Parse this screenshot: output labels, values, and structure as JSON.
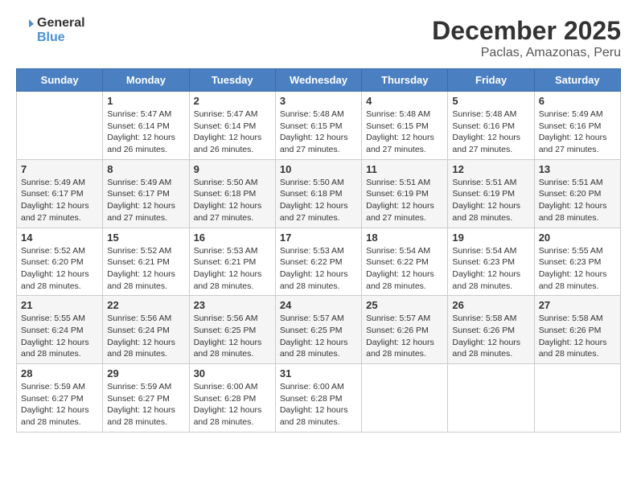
{
  "logo": {
    "line1": "General",
    "line2": "Blue"
  },
  "title": "December 2025",
  "subtitle": "Paclas, Amazonas, Peru",
  "weekdays": [
    "Sunday",
    "Monday",
    "Tuesday",
    "Wednesday",
    "Thursday",
    "Friday",
    "Saturday"
  ],
  "weeks": [
    [
      {
        "day": "",
        "info": ""
      },
      {
        "day": "1",
        "info": "Sunrise: 5:47 AM\nSunset: 6:14 PM\nDaylight: 12 hours\nand 26 minutes."
      },
      {
        "day": "2",
        "info": "Sunrise: 5:47 AM\nSunset: 6:14 PM\nDaylight: 12 hours\nand 26 minutes."
      },
      {
        "day": "3",
        "info": "Sunrise: 5:48 AM\nSunset: 6:15 PM\nDaylight: 12 hours\nand 27 minutes."
      },
      {
        "day": "4",
        "info": "Sunrise: 5:48 AM\nSunset: 6:15 PM\nDaylight: 12 hours\nand 27 minutes."
      },
      {
        "day": "5",
        "info": "Sunrise: 5:48 AM\nSunset: 6:16 PM\nDaylight: 12 hours\nand 27 minutes."
      },
      {
        "day": "6",
        "info": "Sunrise: 5:49 AM\nSunset: 6:16 PM\nDaylight: 12 hours\nand 27 minutes."
      }
    ],
    [
      {
        "day": "7",
        "info": "Sunrise: 5:49 AM\nSunset: 6:17 PM\nDaylight: 12 hours\nand 27 minutes."
      },
      {
        "day": "8",
        "info": "Sunrise: 5:49 AM\nSunset: 6:17 PM\nDaylight: 12 hours\nand 27 minutes."
      },
      {
        "day": "9",
        "info": "Sunrise: 5:50 AM\nSunset: 6:18 PM\nDaylight: 12 hours\nand 27 minutes."
      },
      {
        "day": "10",
        "info": "Sunrise: 5:50 AM\nSunset: 6:18 PM\nDaylight: 12 hours\nand 27 minutes."
      },
      {
        "day": "11",
        "info": "Sunrise: 5:51 AM\nSunset: 6:19 PM\nDaylight: 12 hours\nand 27 minutes."
      },
      {
        "day": "12",
        "info": "Sunrise: 5:51 AM\nSunset: 6:19 PM\nDaylight: 12 hours\nand 28 minutes."
      },
      {
        "day": "13",
        "info": "Sunrise: 5:51 AM\nSunset: 6:20 PM\nDaylight: 12 hours\nand 28 minutes."
      }
    ],
    [
      {
        "day": "14",
        "info": "Sunrise: 5:52 AM\nSunset: 6:20 PM\nDaylight: 12 hours\nand 28 minutes."
      },
      {
        "day": "15",
        "info": "Sunrise: 5:52 AM\nSunset: 6:21 PM\nDaylight: 12 hours\nand 28 minutes."
      },
      {
        "day": "16",
        "info": "Sunrise: 5:53 AM\nSunset: 6:21 PM\nDaylight: 12 hours\nand 28 minutes."
      },
      {
        "day": "17",
        "info": "Sunrise: 5:53 AM\nSunset: 6:22 PM\nDaylight: 12 hours\nand 28 minutes."
      },
      {
        "day": "18",
        "info": "Sunrise: 5:54 AM\nSunset: 6:22 PM\nDaylight: 12 hours\nand 28 minutes."
      },
      {
        "day": "19",
        "info": "Sunrise: 5:54 AM\nSunset: 6:23 PM\nDaylight: 12 hours\nand 28 minutes."
      },
      {
        "day": "20",
        "info": "Sunrise: 5:55 AM\nSunset: 6:23 PM\nDaylight: 12 hours\nand 28 minutes."
      }
    ],
    [
      {
        "day": "21",
        "info": "Sunrise: 5:55 AM\nSunset: 6:24 PM\nDaylight: 12 hours\nand 28 minutes."
      },
      {
        "day": "22",
        "info": "Sunrise: 5:56 AM\nSunset: 6:24 PM\nDaylight: 12 hours\nand 28 minutes."
      },
      {
        "day": "23",
        "info": "Sunrise: 5:56 AM\nSunset: 6:25 PM\nDaylight: 12 hours\nand 28 minutes."
      },
      {
        "day": "24",
        "info": "Sunrise: 5:57 AM\nSunset: 6:25 PM\nDaylight: 12 hours\nand 28 minutes."
      },
      {
        "day": "25",
        "info": "Sunrise: 5:57 AM\nSunset: 6:26 PM\nDaylight: 12 hours\nand 28 minutes."
      },
      {
        "day": "26",
        "info": "Sunrise: 5:58 AM\nSunset: 6:26 PM\nDaylight: 12 hours\nand 28 minutes."
      },
      {
        "day": "27",
        "info": "Sunrise: 5:58 AM\nSunset: 6:26 PM\nDaylight: 12 hours\nand 28 minutes."
      }
    ],
    [
      {
        "day": "28",
        "info": "Sunrise: 5:59 AM\nSunset: 6:27 PM\nDaylight: 12 hours\nand 28 minutes."
      },
      {
        "day": "29",
        "info": "Sunrise: 5:59 AM\nSunset: 6:27 PM\nDaylight: 12 hours\nand 28 minutes."
      },
      {
        "day": "30",
        "info": "Sunrise: 6:00 AM\nSunset: 6:28 PM\nDaylight: 12 hours\nand 28 minutes."
      },
      {
        "day": "31",
        "info": "Sunrise: 6:00 AM\nSunset: 6:28 PM\nDaylight: 12 hours\nand 28 minutes."
      },
      {
        "day": "",
        "info": ""
      },
      {
        "day": "",
        "info": ""
      },
      {
        "day": "",
        "info": ""
      }
    ]
  ]
}
